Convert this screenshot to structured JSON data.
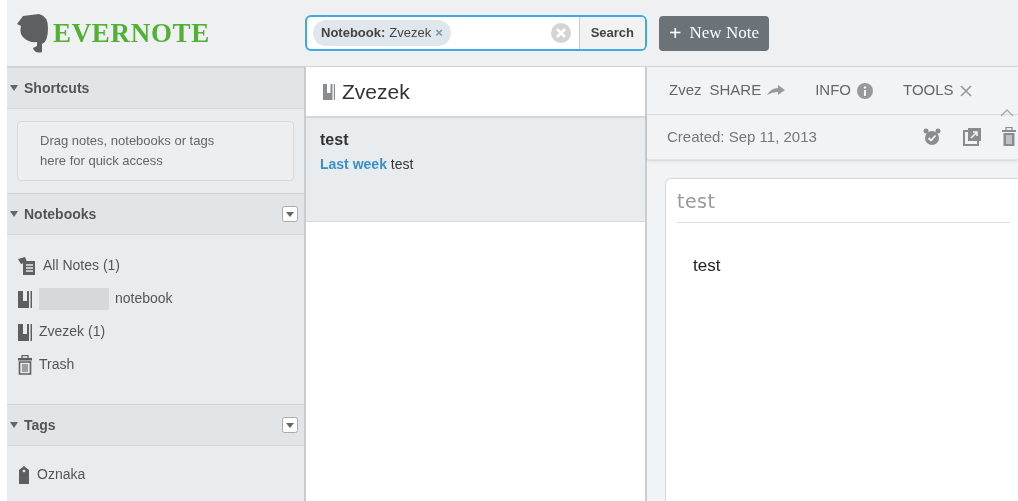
{
  "logo": {
    "text": "EVERNOTE"
  },
  "search": {
    "token_label": "Notebook:",
    "token_value": "Zvezek",
    "token_remove": "×",
    "button": "Search"
  },
  "new_note_button": {
    "icon": "+",
    "label": "New Note"
  },
  "sidebar": {
    "sections": [
      {
        "kind": "shortcuts",
        "title": "Shortcuts",
        "expanded": true,
        "hint": "Drag notes, notebooks or tags here for quick access"
      },
      {
        "kind": "notebooks",
        "title": "Notebooks",
        "expanded": true,
        "items": [
          {
            "kind": "all-notes",
            "label": "All Notes",
            "count": "(1)",
            "redacted": false
          },
          {
            "kind": "notebook",
            "label": "notebook",
            "redacted": true
          },
          {
            "kind": "notebook",
            "label": "Zvezek",
            "count": "(1)",
            "redacted": false
          },
          {
            "kind": "trash",
            "label": "Trash",
            "redacted": false
          }
        ]
      },
      {
        "kind": "tags",
        "title": "Tags",
        "expanded": true,
        "items": [
          {
            "kind": "tag",
            "label": "Oznaka",
            "redacted": false
          }
        ]
      }
    ]
  },
  "note_list": {
    "title": "Zvezek",
    "notes": [
      {
        "title": "test",
        "date": "Last week",
        "snippet": "test",
        "selected": true
      }
    ]
  },
  "note_panel": {
    "toolbar": [
      {
        "kind": "text",
        "label": "Zvez"
      },
      {
        "kind": "share",
        "label": "SHARE"
      },
      {
        "kind": "info",
        "label": "INFO"
      },
      {
        "kind": "tools",
        "label": "TOOLS"
      }
    ],
    "created": "Created: Sep 11, 2013",
    "title_placeholder": "test",
    "body": "test"
  }
}
